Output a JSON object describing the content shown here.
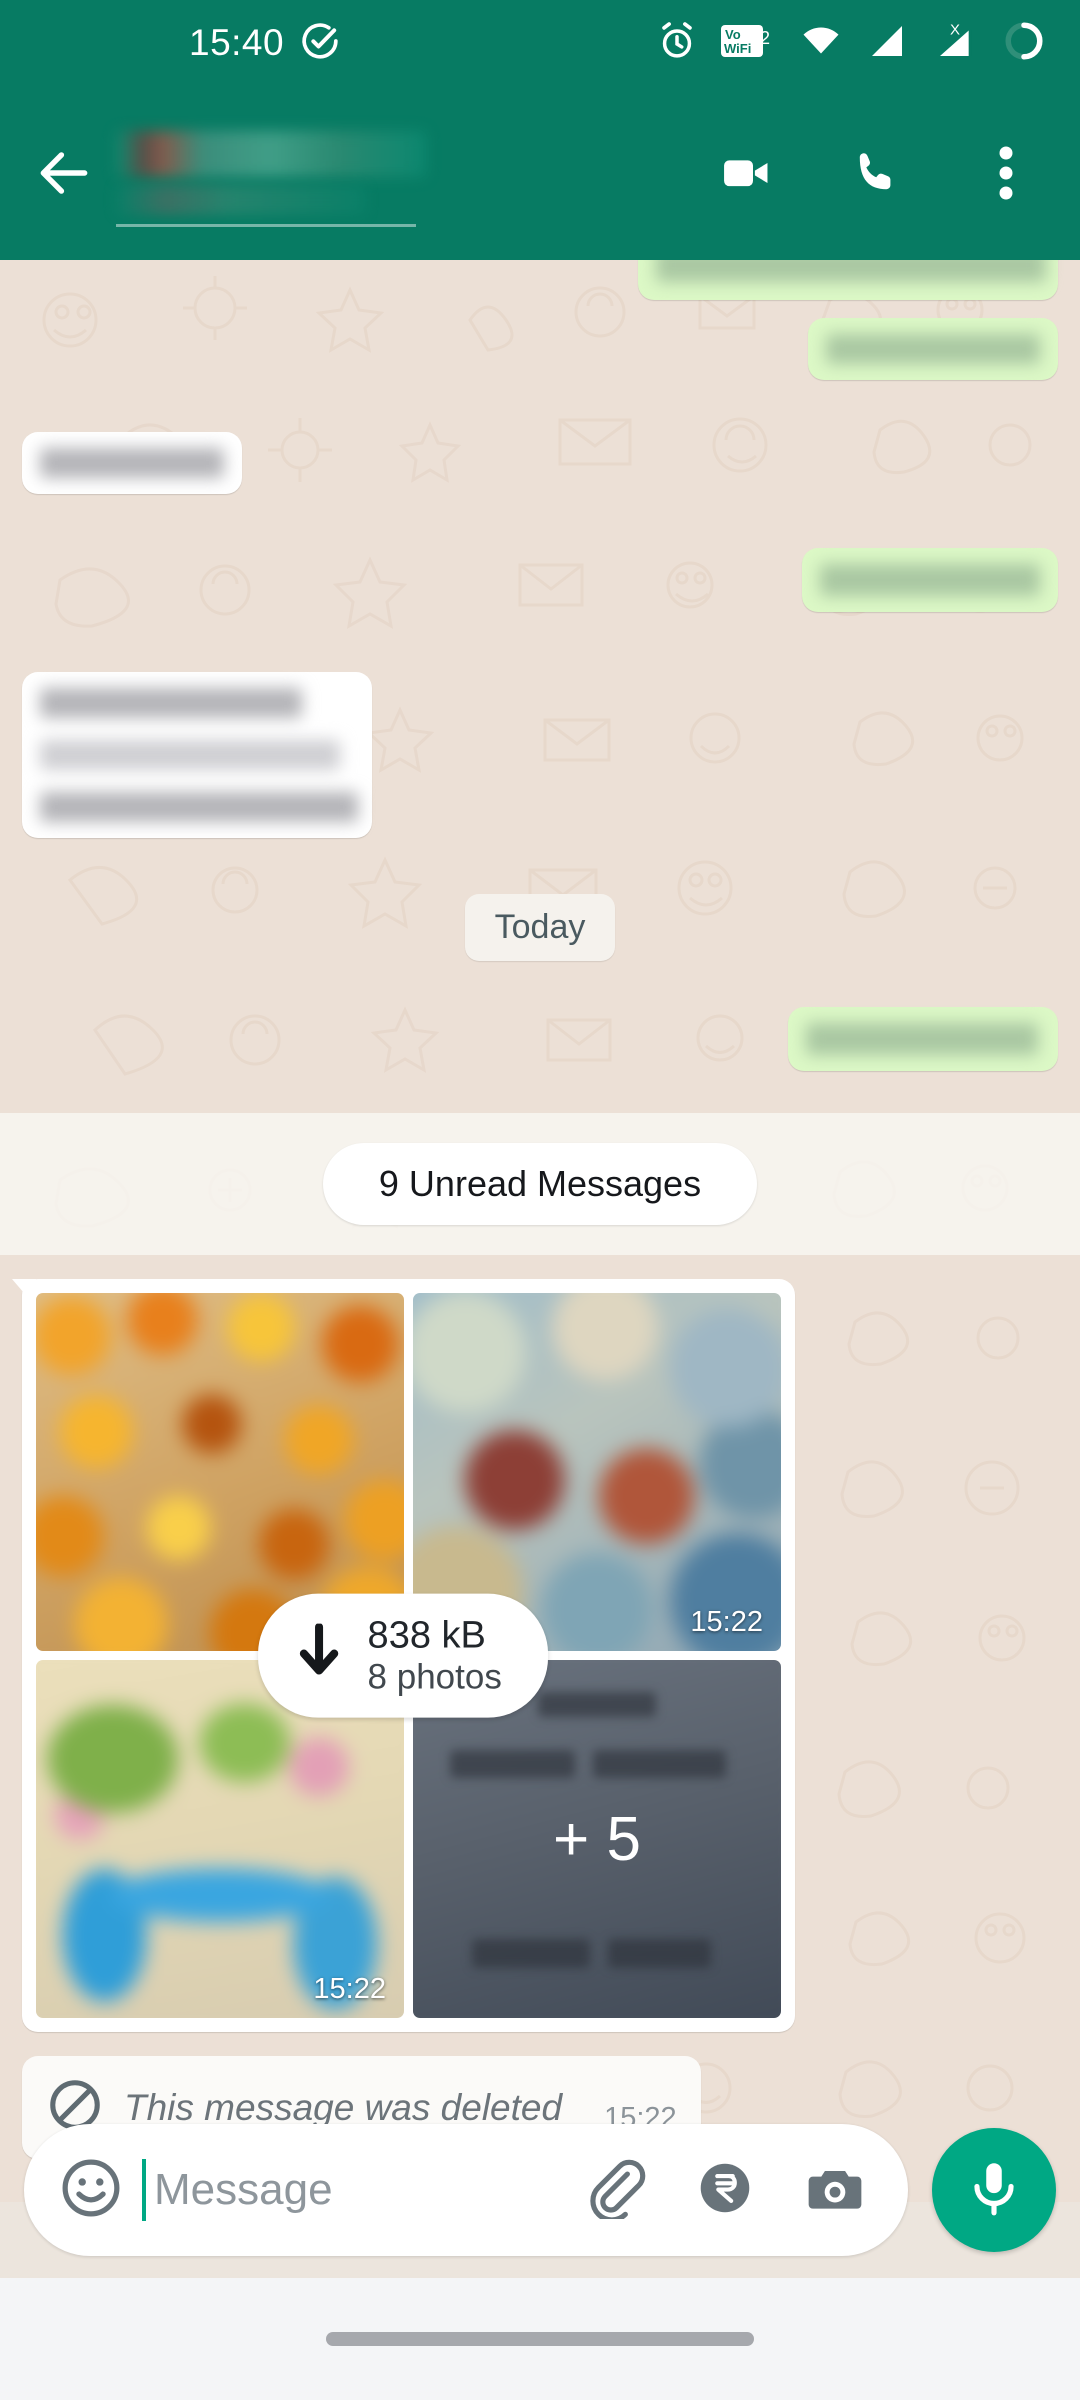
{
  "status_bar": {
    "time": "15:40",
    "icons": [
      "check-circle-icon",
      "alarm-clock-icon",
      "vowifi2-icon",
      "wifi-icon",
      "signal-bars-icon",
      "signal-no-sim-icon",
      "battery-circle-icon"
    ],
    "vowifi_label": "Vo",
    "vowifi_label2": "WiFi",
    "vowifi_sim": "2",
    "nosim_mark": "X"
  },
  "header": {
    "back_icon": "arrow-left-icon",
    "contact_name": "",
    "contact_status": "",
    "video_call_icon": "video-camera-icon",
    "voice_call_icon": "phone-icon",
    "overflow_icon": "more-vertical-icon"
  },
  "chat": {
    "date_divider": "Today",
    "unread_banner": "9 Unread Messages",
    "album": {
      "download_size": "838 kB",
      "download_count": "8 photos",
      "download_icon": "arrow-down-icon",
      "more_overlay": "+ 5",
      "photos": [
        {
          "name": "fried-snack-photo",
          "timestamp": ""
        },
        {
          "name": "street-scene-photo",
          "timestamp": "15:22"
        },
        {
          "name": "blue-bicycle-photo",
          "timestamp": "15:22"
        },
        {
          "name": "dark-text-photo",
          "timestamp": ""
        }
      ]
    },
    "deleted_message": {
      "icon": "blocked-circle-icon",
      "text": "This message was deleted",
      "timestamp": "15:22"
    }
  },
  "input_bar": {
    "emoji_icon": "smiley-icon",
    "placeholder": "Message",
    "attach_icon": "paperclip-icon",
    "payment_icon": "rupee-icon",
    "camera_icon": "camera-icon",
    "mic_icon": "microphone-icon"
  },
  "nav_bar": {
    "gesture_handle": "home-gesture-pill"
  },
  "colors": {
    "header_green": "#077b63",
    "accent_green": "#00a884",
    "outgoing_bubble": "#dcf8c6",
    "incoming_bubble": "#ffffff",
    "chat_background": "#ece0d6"
  }
}
